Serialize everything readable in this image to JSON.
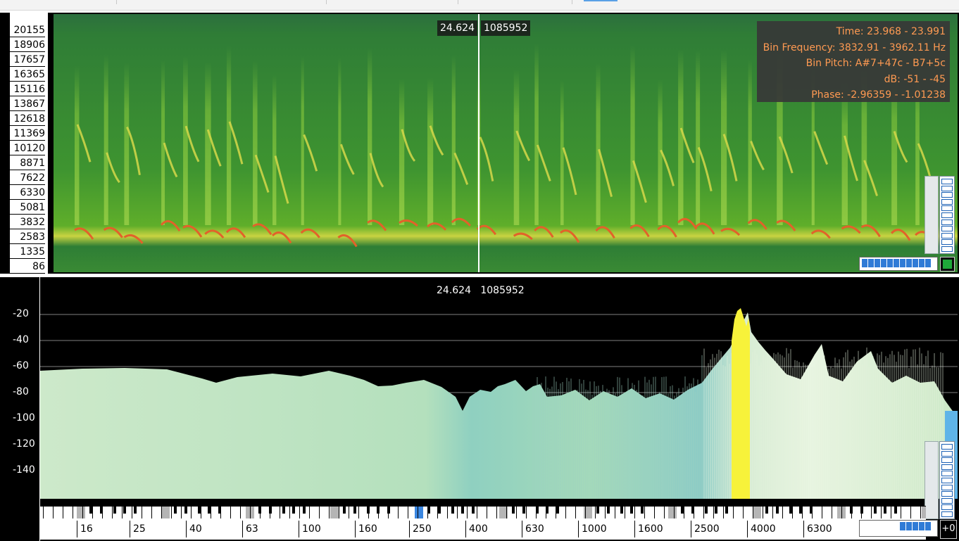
{
  "spectrogram": {
    "y_labels": [
      "20155",
      "18906",
      "17657",
      "16365",
      "15116",
      "13867",
      "12618",
      "11369",
      "10120",
      "8871",
      "7622",
      "6330",
      "5081",
      "3832",
      "2583",
      "1335",
      "86"
    ],
    "cursor_time": "24.624",
    "cursor_sample": "1085952",
    "info": {
      "time": "Time: 23.968 - 23.991",
      "bin_frequency": "Bin Frequency: 3832.91 - 3962.11 Hz",
      "bin_pitch": "Bin Pitch: A#7+47c - B7+5c",
      "db": "dB: -51 - -45",
      "phase": "Phase: -2.96359 - -1.01238"
    },
    "colors": {
      "background": "#3a8a2e",
      "band": "#c8d43a",
      "hot": "#e05a22"
    }
  },
  "spectrum": {
    "y_labels": [
      "-20",
      "-40",
      "-60",
      "-80",
      "-100",
      "-120",
      "-140"
    ],
    "cursor_time": "24.624",
    "cursor_sample": "1085952",
    "x_labels": [
      "16",
      "25",
      "40",
      "63",
      "100",
      "160",
      "250",
      "400",
      "630",
      "1000",
      "1600",
      "2500",
      "4000",
      "6300"
    ],
    "zoom_offset": "+0",
    "colors": {
      "fill": "#c6e8c8",
      "peak": "#f7f23a",
      "grid": "#808080"
    }
  }
}
